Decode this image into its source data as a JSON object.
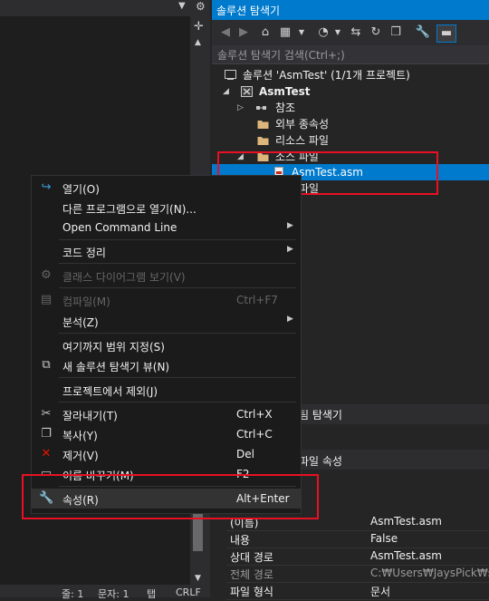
{
  "left_pane": {
    "status": {
      "line": "줄: 1",
      "char": "문자: 1",
      "tab": "탭",
      "crlf": "CRLF"
    }
  },
  "solution_explorer": {
    "title": "솔루션 탐색기",
    "search_placeholder": "솔루션 탐색기 검색(Ctrl+;)",
    "tree": [
      {
        "label": "솔루션 'AsmTest' (1/1개 프로젝트)",
        "icon": "solution-icon"
      },
      {
        "label": "AsmTest",
        "icon": "project-icon",
        "bold": true
      },
      {
        "label": "참조",
        "icon": "references-icon"
      },
      {
        "label": "외부 종속성",
        "icon": "folder-icon"
      },
      {
        "label": "리소스 파일",
        "icon": "folder-icon"
      },
      {
        "label": "소스 파일",
        "icon": "folder-icon"
      },
      {
        "label": "AsmTest.asm",
        "icon": "asm-file-icon",
        "selected": true
      },
      {
        "label": "파일",
        "icon": "folder-icon"
      }
    ],
    "team_tab_label": "팀 탐색기",
    "properties_title": "파일 속성"
  },
  "properties": [
    {
      "key": "(이름)",
      "value": "AsmTest.asm"
    },
    {
      "key": "내용",
      "value": "False"
    },
    {
      "key": "상대 경로",
      "value": "AsmTest.asm"
    },
    {
      "key": "전체 경로",
      "value": "C:₩Users₩JaysPick₩sour"
    },
    {
      "key": "파일 형식",
      "value": "문서"
    }
  ],
  "context_menu": [
    {
      "label": "열기(O)",
      "icon": "open-icon"
    },
    {
      "label": "다른 프로그램으로 열기(N)..."
    },
    {
      "label": "Open Command Line",
      "submenu": true
    },
    {
      "label": "코드 정리",
      "submenu": true
    },
    {
      "label": "클래스 다이어그램 보기(V)",
      "disabled": true,
      "icon": "class-diagram-icon"
    },
    {
      "label": "컴파일(M)",
      "shortcut": "Ctrl+F7",
      "disabled": true,
      "icon": "compile-icon"
    },
    {
      "label": "분석(Z)",
      "submenu": true
    },
    {
      "label": "여기까지 범위 지정(S)"
    },
    {
      "label": "새 솔루션 탐색기 뷰(N)",
      "icon": "new-view-icon"
    },
    {
      "label": "프로젝트에서 제외(J)"
    },
    {
      "label": "잘라내기(T)",
      "shortcut": "Ctrl+X",
      "icon": "cut-icon"
    },
    {
      "label": "복사(Y)",
      "shortcut": "Ctrl+C",
      "icon": "copy-icon"
    },
    {
      "label": "제거(V)",
      "shortcut": "Del",
      "icon": "delete-icon"
    },
    {
      "label": "이름 바꾸기(M)",
      "shortcut": "F2",
      "icon": "rename-icon"
    },
    {
      "label": "속성(R)",
      "shortcut": "Alt+Enter",
      "icon": "properties-wrench-icon",
      "highlighted": true
    }
  ],
  "colors": {
    "accent": "#007acc",
    "highlight_box": "#e81123"
  }
}
